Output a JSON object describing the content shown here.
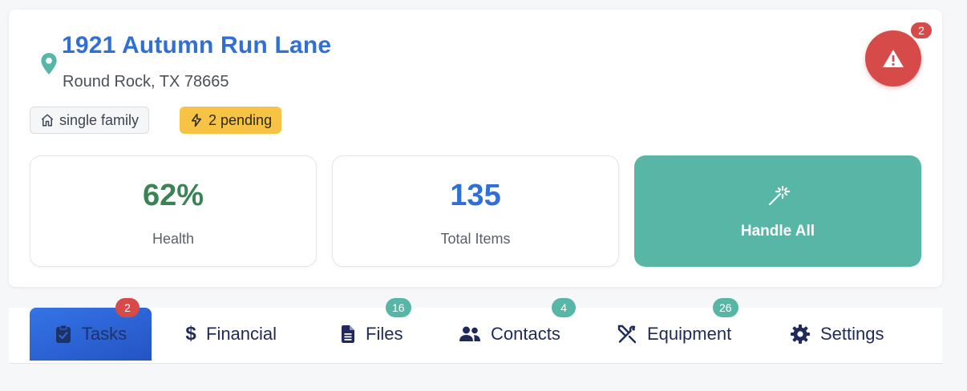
{
  "property": {
    "address": "1921 Autumn Run Lane",
    "city_line": "Round Rock, TX 78665",
    "type_chip": "single family",
    "pending_chip": "2 pending",
    "alert_count": "2"
  },
  "stats": {
    "health_value": "62%",
    "health_label": "Health",
    "items_value": "135",
    "items_label": "Total Items"
  },
  "actions": {
    "handle_all_label": "Handle All"
  },
  "tabs": [
    {
      "label": "Tasks",
      "badge": "2",
      "icon": "clipboard-check-icon",
      "active": true
    },
    {
      "label": "Financial",
      "badge": "",
      "icon": "dollar-icon",
      "active": false
    },
    {
      "label": "Files",
      "badge": "16",
      "icon": "file-icon",
      "active": false
    },
    {
      "label": "Contacts",
      "badge": "4",
      "icon": "users-icon",
      "active": false
    },
    {
      "label": "Equipment",
      "badge": "26",
      "icon": "tools-icon",
      "active": false
    },
    {
      "label": "Settings",
      "badge": "",
      "icon": "gear-icon",
      "active": false
    }
  ],
  "colors": {
    "accent_blue": "#2f6fd6",
    "teal": "#58b6a6",
    "danger": "#d64a4a",
    "warning": "#f6c344",
    "health_green": "#3b8255"
  }
}
